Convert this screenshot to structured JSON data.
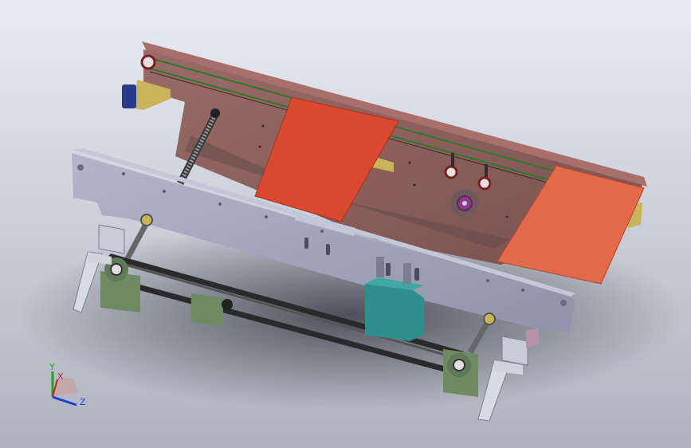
{
  "viewport": {
    "background_top": "#e9ecf1",
    "background_bottom": "#aeb3bf"
  },
  "model": {
    "upper_plate_color": "#8d5f5a",
    "front_plate_color": "#9ea2ba",
    "conveyor_pad_color": "#d9482f",
    "conveyor_pad_right_color": "#e26a4a",
    "motor_color": "#2f8f8c",
    "bearing_block_color": "#6d8a63",
    "belt_color": "#2a2a2a",
    "bracket_color": "#c8b55a",
    "cap_color": "#2a3a8a"
  },
  "triad": {
    "y_label": "Y",
    "x_label": "X",
    "z_label": "Z",
    "y_color": "#1fa61f",
    "x_color": "#d22020",
    "z_color": "#1f3fd2"
  }
}
